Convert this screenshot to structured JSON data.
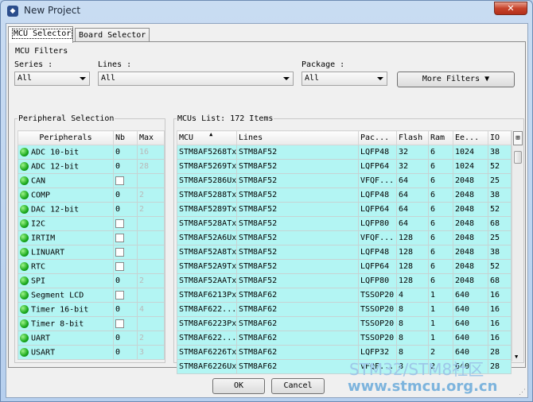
{
  "window": {
    "title": "New Project"
  },
  "tabs": [
    {
      "label": "MCU Selector"
    },
    {
      "label": "Board Selector"
    }
  ],
  "filters": {
    "group_title": "MCU Filters",
    "series_label": "Series :",
    "series_value": "All",
    "lines_label": "Lines :",
    "lines_value": "All",
    "package_label": "Package :",
    "package_value": "All",
    "more_filters_label": "More Filters"
  },
  "peripherals": {
    "group_title": "Peripheral Selection",
    "headers": [
      "Peripherals",
      "Nb",
      "Max"
    ],
    "rows": [
      {
        "name": "ADC 10-bit",
        "nb": "0",
        "max": "16"
      },
      {
        "name": "ADC 12-bit",
        "nb": "0",
        "max": "28"
      },
      {
        "name": "CAN",
        "nb": "",
        "max": ""
      },
      {
        "name": "COMP",
        "nb": "0",
        "max": "2"
      },
      {
        "name": "DAC 12-bit",
        "nb": "0",
        "max": "2"
      },
      {
        "name": "I2C",
        "nb": "",
        "max": ""
      },
      {
        "name": "IRTIM",
        "nb": "",
        "max": ""
      },
      {
        "name": "LINUART",
        "nb": "",
        "max": ""
      },
      {
        "name": "RTC",
        "nb": "",
        "max": ""
      },
      {
        "name": "SPI",
        "nb": "0",
        "max": "2"
      },
      {
        "name": "Segment LCD",
        "nb": "",
        "max": ""
      },
      {
        "name": "Timer 16-bit",
        "nb": "0",
        "max": "4"
      },
      {
        "name": "Timer 8-bit",
        "nb": "",
        "max": ""
      },
      {
        "name": "UART",
        "nb": "0",
        "max": "2"
      },
      {
        "name": "USART",
        "nb": "0",
        "max": "3"
      }
    ]
  },
  "mcu_list": {
    "group_title": "MCUs List: 172 Items",
    "headers": [
      "MCU",
      "Lines",
      "Pac...",
      "Flash",
      "Ram",
      "Ee...",
      "IO"
    ],
    "rows": [
      [
        "STM8AF5268Tx",
        "STM8AF52",
        "LQFP48",
        "32",
        "6",
        "1024",
        "38"
      ],
      [
        "STM8AF5269Tx",
        "STM8AF52",
        "LQFP64",
        "32",
        "6",
        "1024",
        "52"
      ],
      [
        "STM8AF5286Ux",
        "STM8AF52",
        "VFQF...",
        "64",
        "6",
        "2048",
        "25"
      ],
      [
        "STM8AF5288Tx",
        "STM8AF52",
        "LQFP48",
        "64",
        "6",
        "2048",
        "38"
      ],
      [
        "STM8AF5289Tx",
        "STM8AF52",
        "LQFP64",
        "64",
        "6",
        "2048",
        "52"
      ],
      [
        "STM8AF528ATx",
        "STM8AF52",
        "LQFP80",
        "64",
        "6",
        "2048",
        "68"
      ],
      [
        "STM8AF52A6Ux",
        "STM8AF52",
        "VFQF...",
        "128",
        "6",
        "2048",
        "25"
      ],
      [
        "STM8AF52A8Tx",
        "STM8AF52",
        "LQFP48",
        "128",
        "6",
        "2048",
        "38"
      ],
      [
        "STM8AF52A9Tx",
        "STM8AF52",
        "LQFP64",
        "128",
        "6",
        "2048",
        "52"
      ],
      [
        "STM8AF52AATx",
        "STM8AF52",
        "LQFP80",
        "128",
        "6",
        "2048",
        "68"
      ],
      [
        "STM8AF6213Px",
        "STM8AF62",
        "TSSOP20",
        "4",
        "1",
        "640",
        "16"
      ],
      [
        "STM8AF622...",
        "STM8AF62",
        "TSSOP20",
        "8",
        "1",
        "640",
        "16"
      ],
      [
        "STM8AF6223Px",
        "STM8AF62",
        "TSSOP20",
        "8",
        "1",
        "640",
        "16"
      ],
      [
        "STM8AF622...",
        "STM8AF62",
        "TSSOP20",
        "8",
        "1",
        "640",
        "16"
      ],
      [
        "STM8AF6226Tx",
        "STM8AF62",
        "LQFP32",
        "8",
        "2",
        "640",
        "28"
      ],
      [
        "STM8AF6226Ux",
        "STM8AF62",
        "VFQF...",
        "8",
        "2",
        "640",
        "28"
      ]
    ]
  },
  "buttons": {
    "ok": "OK",
    "cancel": "Cancel"
  },
  "watermark": {
    "line1": "STM32/STM8社区",
    "line2": "www.stmcu.org.cn"
  }
}
